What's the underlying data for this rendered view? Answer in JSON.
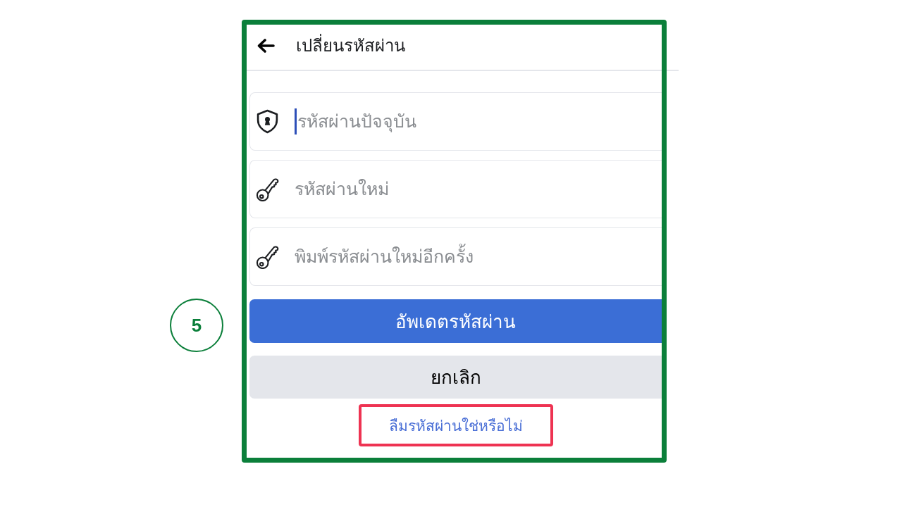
{
  "annotation": {
    "step_number": "5"
  },
  "screen": {
    "header": {
      "title": "เปลี่ยนรหัสผ่าน"
    },
    "fields": [
      {
        "kind": "current-password",
        "placeholder": "รหัสผ่านปัจจุบัน",
        "focused": true
      },
      {
        "kind": "new-password",
        "placeholder": "รหัสผ่านใหม่",
        "focused": false
      },
      {
        "kind": "confirm-password",
        "placeholder": "พิมพ์รหัสผ่านใหม่อีกครั้ง",
        "focused": false
      }
    ],
    "buttons": [
      {
        "kind": "primary",
        "label": "อัพเดตรหัสผ่าน"
      },
      {
        "kind": "secondary",
        "label": "ยกเลิก"
      }
    ],
    "forgot_link": {
      "label": "ลืมรหัสผ่านใช่หรือไม่",
      "highlighted": true
    }
  }
}
